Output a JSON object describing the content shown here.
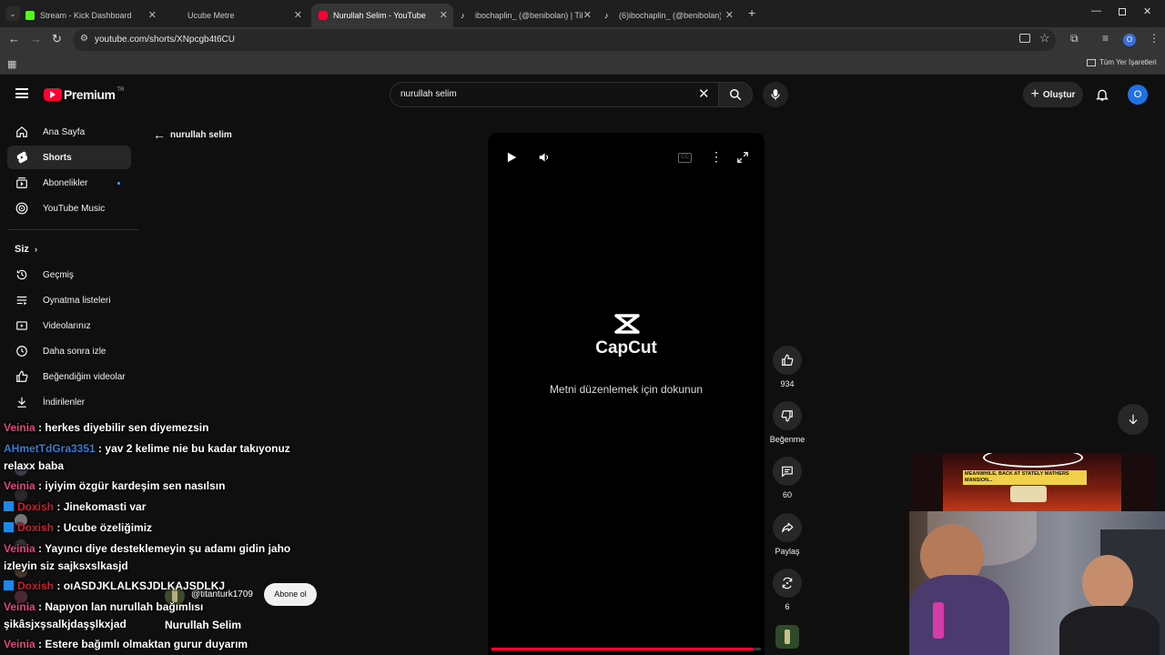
{
  "browser": {
    "tabs": [
      {
        "label": "Stream - Kick Dashboard",
        "icon": "kick-icon"
      },
      {
        "label": "Ucube Metre",
        "icon": ""
      },
      {
        "label": "Nurullah Selim - YouTube",
        "icon": "youtube-icon"
      },
      {
        "label": "ibochaplin_ (@benibolan) | Tik",
        "icon": "tiktok-icon"
      },
      {
        "label": "(6)ibochaplin_ (@benibolan) | T",
        "icon": "tiktok-icon"
      }
    ],
    "url": "youtube.com/shorts/XNpcgb4t6CU",
    "profile_initial": "O",
    "bookmarks_label": "Tüm Yer İşaretleri"
  },
  "youtube": {
    "logo_text": "Premium",
    "region": "TR",
    "search_value": "nurullah selim",
    "create_label": "Oluştur",
    "avatar_initial": "O",
    "sidebar": {
      "main": [
        {
          "label": "Ana Sayfa",
          "icon": "home-icon"
        },
        {
          "label": "Shorts",
          "icon": "shorts-icon"
        },
        {
          "label": "Abonelikler",
          "icon": "subscriptions-icon"
        },
        {
          "label": "YouTube Music",
          "icon": "music-icon"
        }
      ],
      "you_header": "Siz",
      "you": [
        {
          "label": "Geçmiş",
          "icon": "history-icon"
        },
        {
          "label": "Oynatma listeleri",
          "icon": "playlist-icon"
        },
        {
          "label": "Videolarınız",
          "icon": "video-icon"
        },
        {
          "label": "Daha sonra izle",
          "icon": "clock-icon"
        },
        {
          "label": "Beğendiğim videolar",
          "icon": "like-icon"
        },
        {
          "label": "İndirilenler",
          "icon": "download-icon"
        }
      ]
    },
    "back_label": "nurullah selim",
    "player": {
      "capcut_label": "CapCut",
      "hint": "Metni düzenlemek için dokunun",
      "channel_handle": "@titanturk1709",
      "subscribe_label": "Abone ol",
      "title": "Nurullah Selim",
      "progress_fraction": 0.97
    },
    "actions": {
      "likes": "934",
      "dislike_label": "Beğenme",
      "comments": "60",
      "share_label": "Paylaş",
      "remix": "6"
    }
  },
  "chat": [
    {
      "user": "Veinia",
      "color": "#e0457b",
      "text": "herkes diyebilir sen diyemezsin",
      "badge": false
    },
    {
      "user": "AHmetTdGra3351",
      "color": "#3a7bd5",
      "text": "yav 2 kelime nie bu kadar takıyonuz",
      "badge": false
    },
    {
      "user": "",
      "color": "#ffffff",
      "text": "relaxx baba",
      "badge": false
    },
    {
      "user": "Veinia",
      "color": "#e0457b",
      "text": "iyiyim özgür kardeşim sen nasılsın",
      "badge": false
    },
    {
      "user": "Doxish",
      "color": "#d11a2a",
      "text": "Jinekomasti var",
      "badge": true
    },
    {
      "user": "Doxish",
      "color": "#d11a2a",
      "text": "Ucube özeliğimiz",
      "badge": true
    },
    {
      "user": "Veinia",
      "color": "#e0457b",
      "text": "Yayıncı diye desteklemeyin şu adamı gidin jaho",
      "badge": false
    },
    {
      "user": "",
      "color": "#ffffff",
      "text": "izleyin siz sajksxslkasjd",
      "badge": false
    },
    {
      "user": "Doxish",
      "color": "#d11a2a",
      "text": "oıASDJKLALKSJDLKAJSDLKJ",
      "badge": true
    },
    {
      "user": "Veinia",
      "color": "#e0457b",
      "text": "Napıyon lan nurullah bağımlısı",
      "badge": false
    },
    {
      "user": "",
      "color": "#ffffff",
      "text": "şikâsjxşsalkjdaşşlkxjad",
      "badge": false
    },
    {
      "user": "Veinia",
      "color": "#e0457b",
      "text": "Estere bağımlı olmaktan gurur duyarım",
      "badge": false
    }
  ],
  "overlay": {
    "comic_text": "MEANWHILE, BACK AT STATELY MATHERS MANSION..."
  }
}
